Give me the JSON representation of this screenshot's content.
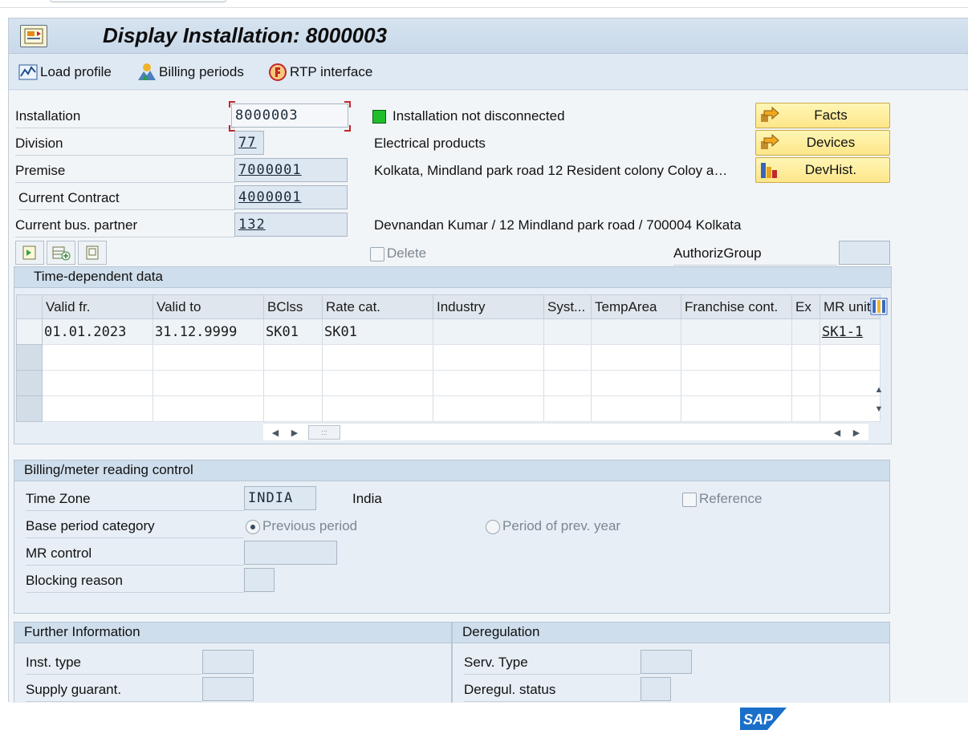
{
  "window": {
    "title": "Display Installation: 8000003"
  },
  "appbar": {
    "load_profile": "Load profile",
    "billing_periods": "Billing periods",
    "rtp_interface": "RTP interface"
  },
  "header": {
    "installation_label": "Installation",
    "installation_value": "8000003",
    "division_label": "Division",
    "division_value": "77",
    "division_text": "Electrical products",
    "premise_label": "Premise",
    "premise_value": "7000001",
    "premise_text": "Kolkata, Mindland park road  12  Resident colony  Coloy a…",
    "contract_label": "Current Contract",
    "contract_value": "4000001",
    "partner_label": "Current bus. partner",
    "partner_value": "132",
    "partner_text": "Devnandan Kumar / 12 Mindland park road / 700004 Kolkata",
    "status_text": "Installation not disconnected",
    "status_color": "#1fbf2b",
    "delete_label": "Delete",
    "authgroup_label": "AuthorizGroup"
  },
  "buttons": {
    "facts": "Facts",
    "devices": "Devices",
    "devhist": "DevHist."
  },
  "time_dependent": {
    "title": "Time-dependent data",
    "columns": [
      "Valid fr.",
      "Valid to",
      "BClss",
      "Rate cat.",
      "Industry",
      "Syst...",
      "TempArea",
      "Franchise cont.",
      "Ex",
      "MR unit"
    ],
    "rows": [
      [
        "01.01.2023",
        "31.12.9999",
        "SK01",
        "SK01",
        "",
        "",
        "",
        "",
        "",
        "SK1-1"
      ]
    ]
  },
  "billing": {
    "title": "Billing/meter reading control",
    "timezone_label": "Time Zone",
    "timezone_value": "INDIA",
    "timezone_text": "India",
    "reference_label": "Reference",
    "base_period_label": "Base period category",
    "previous_period": "Previous period",
    "period_prev_year": "Period of prev. year",
    "mr_control_label": "MR control",
    "blocking_label": "Blocking reason"
  },
  "further": {
    "title": "Further Information",
    "inst_type_label": "Inst. type",
    "supply_label": "Supply guarant."
  },
  "dereg": {
    "title": "Deregulation",
    "serv_type_label": "Serv. Type",
    "dereg_status_label": "Deregul. status"
  },
  "footer": {
    "logo": "SAP",
    "logo_color": "#1a6fc9"
  }
}
